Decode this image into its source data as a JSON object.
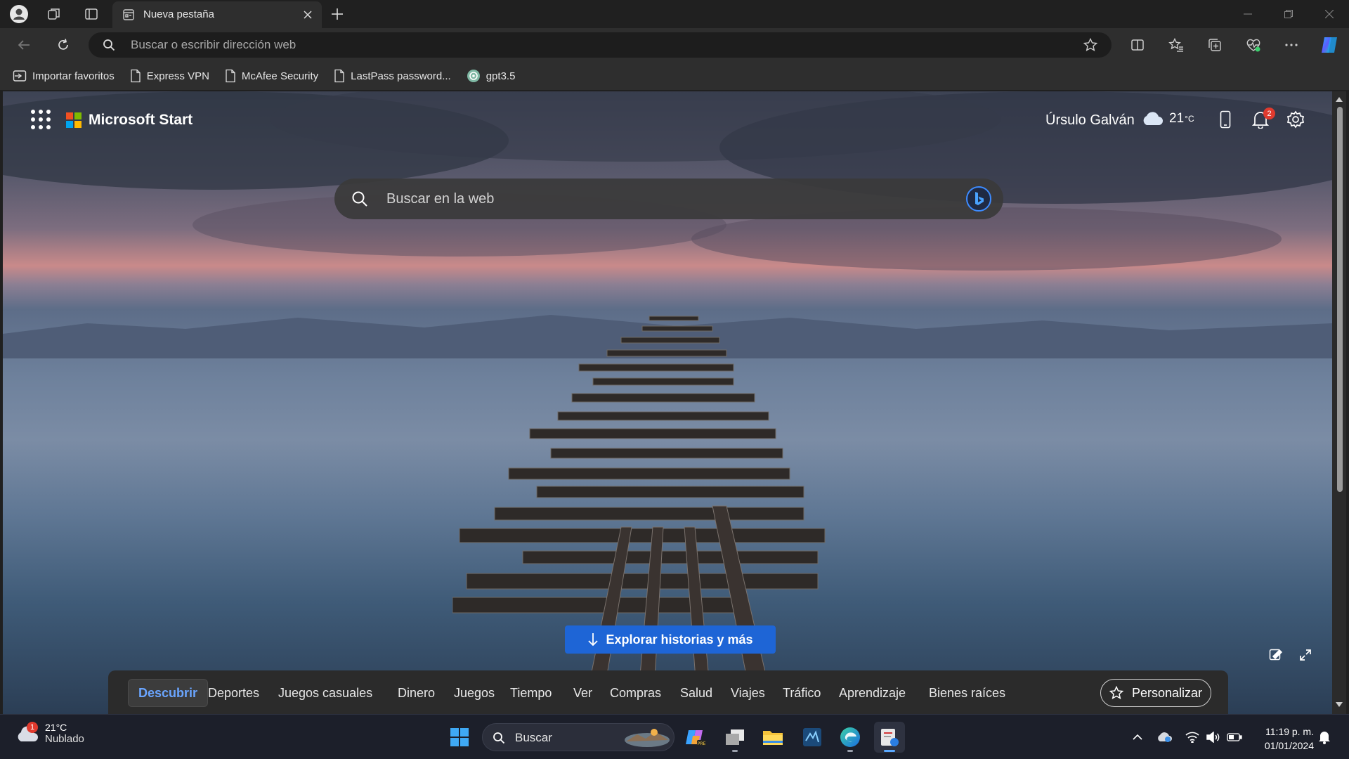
{
  "browser": {
    "tab": {
      "title": "Nueva pestaña"
    },
    "address_bar": {
      "placeholder": "Buscar o escribir dirección web"
    },
    "bookmarks": [
      {
        "label": "Importar favoritos",
        "icon": "import-favorites-icon"
      },
      {
        "label": "Express VPN",
        "icon": "page-icon"
      },
      {
        "label": "McAfee Security",
        "icon": "page-icon"
      },
      {
        "label": "LastPass password...",
        "icon": "page-icon"
      },
      {
        "label": "gpt3.5",
        "icon": "openai-icon"
      }
    ]
  },
  "start_page": {
    "brand": "Microsoft Start",
    "user_name": "Úrsulo Galván",
    "weather": {
      "temperature": "21",
      "unit": "°C",
      "icon": "cloud-icon"
    },
    "notifications_count": "2",
    "search_placeholder": "Buscar en la web",
    "explore_label": "Explorar historias y más",
    "categories": [
      "Descubrir",
      "Deportes",
      "Juegos casuales",
      "Dinero",
      "Juegos",
      "Tiempo",
      "Ver",
      "Compras",
      "Salud",
      "Viajes",
      "Tráfico",
      "Aprendizaje",
      "Bienes raíces"
    ],
    "active_category": "Descubrir",
    "personalize_label": "Personalizar"
  },
  "taskbar": {
    "weather": {
      "temperature": "21°C",
      "condition": "Nublado",
      "badge": "1"
    },
    "search_label": "Buscar",
    "time": "11:19 p. m.",
    "date": "01/01/2024"
  },
  "colors": {
    "accent": "#1e65d6",
    "active_category_text": "#6aa5ff",
    "badge": "#e03a2e"
  }
}
